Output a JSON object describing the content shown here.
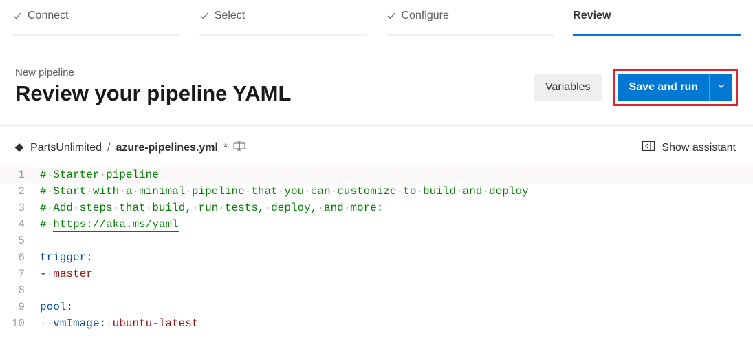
{
  "stepper": {
    "steps": [
      {
        "label": "Connect",
        "done": true,
        "active": false
      },
      {
        "label": "Select",
        "done": true,
        "active": false
      },
      {
        "label": "Configure",
        "done": true,
        "active": false
      },
      {
        "label": "Review",
        "done": false,
        "active": true
      }
    ]
  },
  "header": {
    "subtitle": "New pipeline",
    "title": "Review your pipeline YAML",
    "variables_label": "Variables",
    "save_run_label": "Save and run"
  },
  "filebar": {
    "folder": "PartsUnlimited",
    "separator": "/",
    "filename": "azure-pipelines.yml",
    "dirty_marker": "*",
    "assistant_label": "Show assistant"
  },
  "editor": {
    "lines": [
      {
        "n": 1,
        "tokens": [
          {
            "t": "comment",
            "v": "# Starter pipeline"
          }
        ]
      },
      {
        "n": 2,
        "tokens": [
          {
            "t": "comment",
            "v": "# Start with a minimal pipeline that you can customize to build and deploy"
          }
        ]
      },
      {
        "n": 3,
        "tokens": [
          {
            "t": "comment",
            "v": "# Add steps that build, run tests, deploy, and more:"
          }
        ]
      },
      {
        "n": 4,
        "tokens": [
          {
            "t": "comment",
            "v": "# "
          },
          {
            "t": "comment-underline",
            "v": "https://aka.ms/yaml"
          }
        ]
      },
      {
        "n": 5,
        "tokens": []
      },
      {
        "n": 6,
        "tokens": [
          {
            "t": "key",
            "v": "trigger"
          },
          {
            "t": "plain",
            "v": ":"
          }
        ]
      },
      {
        "n": 7,
        "tokens": [
          {
            "t": "plain",
            "v": "- "
          },
          {
            "t": "location",
            "v": "master"
          }
        ]
      },
      {
        "n": 8,
        "tokens": []
      },
      {
        "n": 9,
        "tokens": [
          {
            "t": "key",
            "v": "pool"
          },
          {
            "t": "plain",
            "v": ":"
          }
        ]
      },
      {
        "n": 10,
        "tokens": [
          {
            "t": "plain",
            "v": "  "
          },
          {
            "t": "key",
            "v": "vmImage"
          },
          {
            "t": "plain",
            "v": ": "
          },
          {
            "t": "location",
            "v": "ubuntu-latest"
          }
        ]
      }
    ],
    "current_line": 1
  }
}
